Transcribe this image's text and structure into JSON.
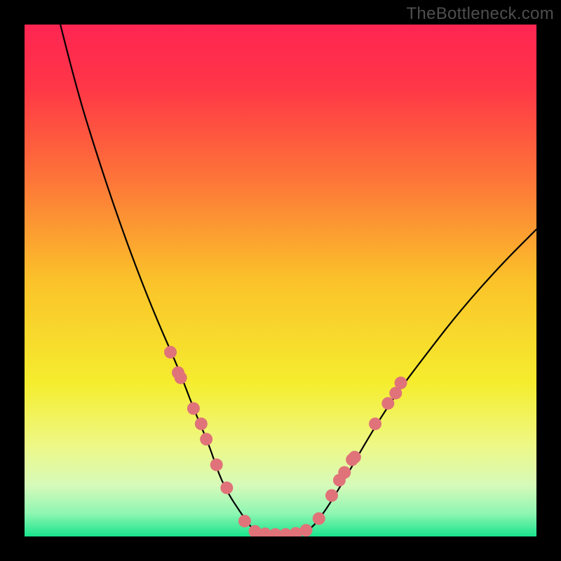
{
  "watermark": "TheBottleneck.com",
  "chart_data": {
    "type": "line",
    "title": "",
    "xlabel": "",
    "ylabel": "",
    "xlim": [
      0,
      100
    ],
    "ylim": [
      0,
      100
    ],
    "grid": false,
    "legend": false,
    "background_gradient_stops": [
      {
        "offset": 0.0,
        "color": "#ff2552"
      },
      {
        "offset": 0.12,
        "color": "#ff3647"
      },
      {
        "offset": 0.3,
        "color": "#fd7439"
      },
      {
        "offset": 0.5,
        "color": "#fbc22a"
      },
      {
        "offset": 0.7,
        "color": "#f5ed2e"
      },
      {
        "offset": 0.82,
        "color": "#eef884"
      },
      {
        "offset": 0.9,
        "color": "#d7faba"
      },
      {
        "offset": 0.955,
        "color": "#8ef6b2"
      },
      {
        "offset": 1.0,
        "color": "#19e48b"
      }
    ],
    "series": [
      {
        "name": "left-branch",
        "stroke": "#000000",
        "x": [
          7,
          10,
          14,
          18,
          22,
          26,
          30,
          33,
          36,
          38,
          40,
          42,
          44,
          46
        ],
        "values": [
          100,
          88,
          75,
          63,
          52,
          42,
          33,
          25,
          18,
          12,
          8,
          5,
          2,
          0.3
        ]
      },
      {
        "name": "right-branch",
        "stroke": "#000000",
        "x": [
          54,
          56,
          58,
          60,
          63,
          67,
          72,
          78,
          85,
          93,
          100
        ],
        "values": [
          0.3,
          1.5,
          4,
          7,
          12,
          19,
          27,
          35,
          44,
          53,
          60
        ]
      },
      {
        "name": "valley-floor",
        "stroke": "#000000",
        "x": [
          46,
          48,
          50,
          52,
          54
        ],
        "values": [
          0.3,
          0.2,
          0.2,
          0.2,
          0.3
        ]
      }
    ],
    "markers": [
      {
        "x": 28.5,
        "y": 36
      },
      {
        "x": 30.0,
        "y": 32
      },
      {
        "x": 30.5,
        "y": 31
      },
      {
        "x": 33.0,
        "y": 25
      },
      {
        "x": 34.5,
        "y": 22
      },
      {
        "x": 35.5,
        "y": 19
      },
      {
        "x": 37.5,
        "y": 14
      },
      {
        "x": 39.5,
        "y": 9.5
      },
      {
        "x": 43.0,
        "y": 3
      },
      {
        "x": 45.0,
        "y": 1
      },
      {
        "x": 47.0,
        "y": 0.5
      },
      {
        "x": 49.0,
        "y": 0.4
      },
      {
        "x": 51.0,
        "y": 0.4
      },
      {
        "x": 53.0,
        "y": 0.6
      },
      {
        "x": 55.0,
        "y": 1.2
      },
      {
        "x": 57.5,
        "y": 3.5
      },
      {
        "x": 60.0,
        "y": 8
      },
      {
        "x": 61.5,
        "y": 11
      },
      {
        "x": 62.5,
        "y": 12.5
      },
      {
        "x": 64.0,
        "y": 15
      },
      {
        "x": 64.5,
        "y": 15.5
      },
      {
        "x": 68.5,
        "y": 22
      },
      {
        "x": 71.0,
        "y": 26
      },
      {
        "x": 72.5,
        "y": 28
      },
      {
        "x": 73.5,
        "y": 30
      }
    ],
    "marker_style": {
      "color": "#e07379",
      "radius_px": 9
    }
  }
}
